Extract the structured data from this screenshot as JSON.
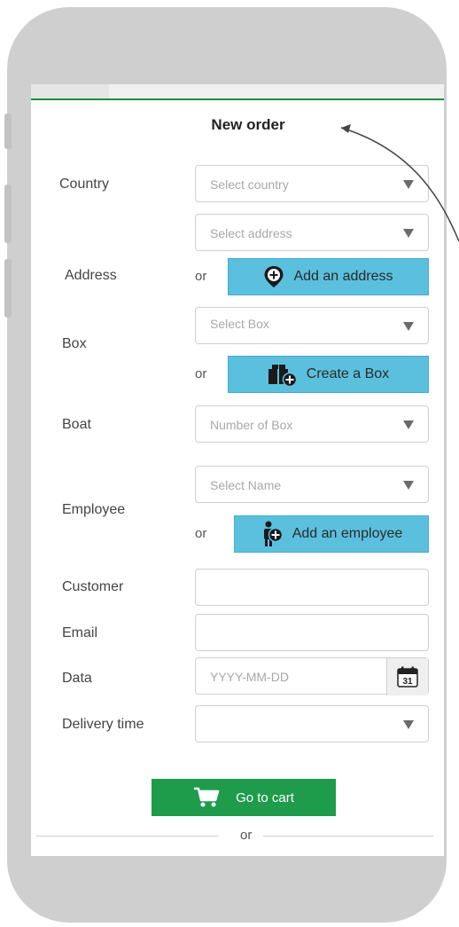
{
  "form": {
    "title": "New order",
    "country": {
      "label": "Country",
      "placeholder": "Select country"
    },
    "address": {
      "label": "Address",
      "placeholder": "Select address",
      "or": "or",
      "add_button": "Add an address"
    },
    "box": {
      "label": "Box",
      "placeholder": "Select Box",
      "or": "or",
      "create_button": "Create a Box"
    },
    "boat": {
      "label": "Boat",
      "placeholder": "Number of Box"
    },
    "employee": {
      "label": "Employee",
      "placeholder": "Select Name",
      "or": "or",
      "add_button": "Add an employee"
    },
    "customer": {
      "label": "Customer",
      "value": ""
    },
    "email": {
      "label": "Email",
      "value": ""
    },
    "data": {
      "label": "Data",
      "placeholder": "YYYY-MM-DD",
      "calendar_day": "31"
    },
    "delivery_time": {
      "label": "Delivery time",
      "value": ""
    },
    "cart_button": "Go to cart",
    "divider_or": "or"
  },
  "icons": {
    "dropdown": "chevron-down-icon",
    "add_address": "map-pin-plus-icon",
    "create_box": "box-plus-icon",
    "add_employee": "person-plus-icon",
    "calendar": "calendar-icon",
    "cart": "shopping-cart-icon"
  },
  "colors": {
    "accent_green": "#1e9b4b",
    "button_blue": "#5bc0de",
    "phone_frame": "#cfcfcf"
  }
}
